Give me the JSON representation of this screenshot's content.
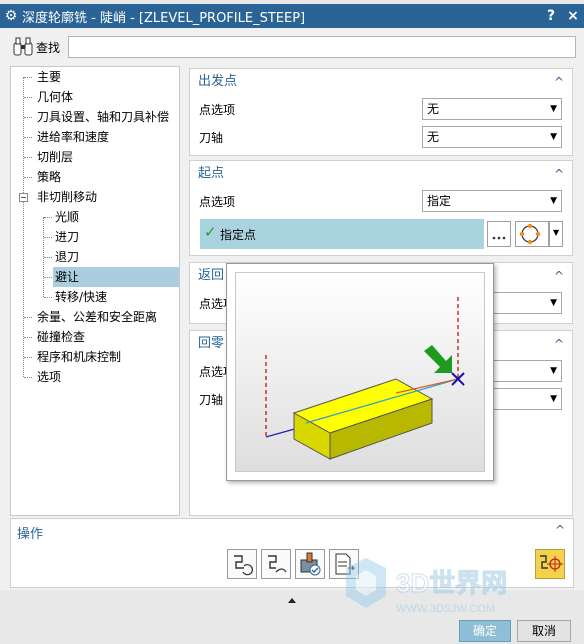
{
  "window": {
    "title": "深度轮廓铣 - 陡峭 - [ZLEVEL_PROFILE_STEEP]",
    "help_label": "?",
    "close_label": "×"
  },
  "search": {
    "label": "查找",
    "value": ""
  },
  "tree": {
    "items": [
      {
        "label": "主要"
      },
      {
        "label": "几何体"
      },
      {
        "label": "刀具设置、轴和刀具补偿"
      },
      {
        "label": "进给率和速度"
      },
      {
        "label": "切削层"
      },
      {
        "label": "策略"
      },
      {
        "label": "非切削移动"
      },
      {
        "label": "光顺"
      },
      {
        "label": "进刀"
      },
      {
        "label": "退刀"
      },
      {
        "label": "避让"
      },
      {
        "label": "转移/快速"
      },
      {
        "label": "余量、公差和安全距离"
      },
      {
        "label": "碰撞检查"
      },
      {
        "label": "程序和机床控制"
      },
      {
        "label": "选项"
      }
    ],
    "selected": "避让"
  },
  "panels": {
    "departure": {
      "title": "出发点",
      "point_option_label": "点选项",
      "point_option_value": "无",
      "tool_axis_label": "刀轴",
      "tool_axis_value": "无"
    },
    "start": {
      "title": "起点",
      "point_option_label": "点选项",
      "point_option_value": "指定",
      "specify_point_label": "指定点"
    },
    "return": {
      "title": "返回",
      "point_option_label": "点选项"
    },
    "home": {
      "title": "回零",
      "point_option_label": "点选项",
      "tool_axis_label": "刀轴"
    }
  },
  "operation": {
    "title": "操作"
  },
  "buttons": {
    "ok": "确定",
    "cancel": "取消"
  },
  "watermark": {
    "text": "3D世界网",
    "url": "WWW.3DSJW.COM"
  },
  "colors": {
    "title_bar": "#2a6496",
    "accent": "#2a6496",
    "selection": "#aacde0",
    "check": "#2b9a2b"
  }
}
